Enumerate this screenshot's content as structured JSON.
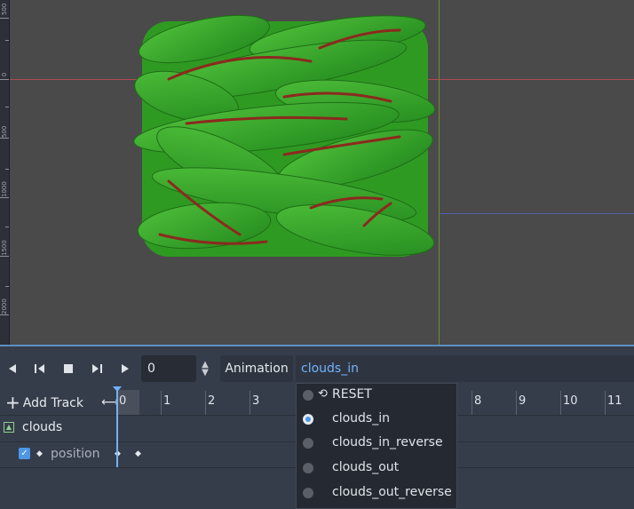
{
  "ruler": {
    "labels": [
      "500",
      "0",
      "500",
      "1000",
      "1500",
      "2000"
    ]
  },
  "toolbar": {
    "frame_value": "0",
    "animation_label": "Animation",
    "animation_selected": "clouds_in"
  },
  "timeline": {
    "add_track_label": "Add Track",
    "ticks": [
      "0",
      "1",
      "2",
      "3",
      "8",
      "9",
      "10",
      "11"
    ]
  },
  "tracks": [
    {
      "node": "clouds",
      "property": "position"
    }
  ],
  "dropdown": {
    "options": [
      "RESET",
      "clouds_in",
      "clouds_in_reverse",
      "clouds_out",
      "clouds_out_reverse"
    ],
    "selected": "clouds_in"
  },
  "colors": {
    "accent": "#4d97e6",
    "selected_text": "#71b2ff",
    "leaf_green": "#3aa02a",
    "leaf_red": "#8b2a1e"
  },
  "icons": {
    "reset": "undo-arrow-icon",
    "track_node": "sprite-node-icon"
  }
}
